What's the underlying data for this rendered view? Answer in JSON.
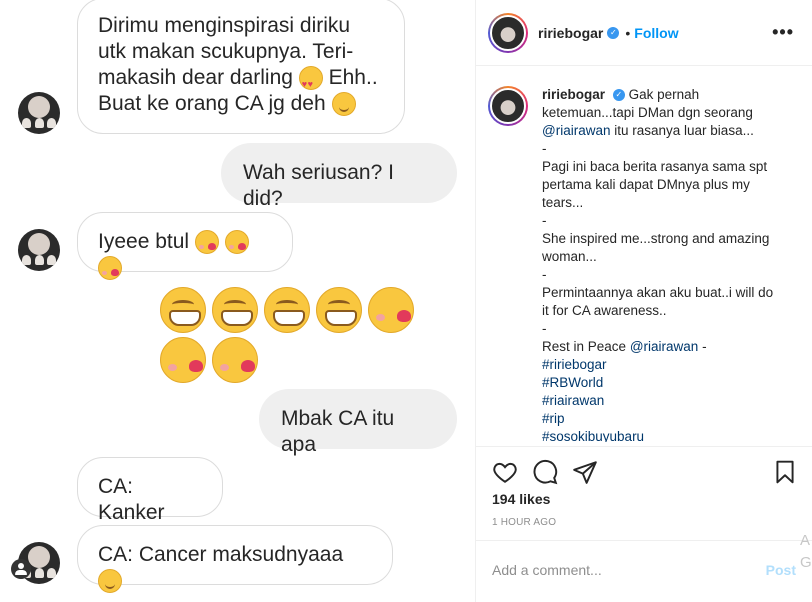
{
  "chat": {
    "messages": [
      {
        "side": "in",
        "text": "Dirimu menginspirasi diriku utk makan scukupnya. Teri-makasih dear darling",
        "emoji_after": "heart-eyes",
        "tail": "Ehh.. Buat ke orang CA jg deh",
        "tail_emoji": "smile"
      },
      {
        "side": "out",
        "text": "Wah seriusan? I did?"
      },
      {
        "side": "in",
        "text": "Iyeee btul"
      },
      {
        "side": "out",
        "text": "Mbak CA itu apa"
      },
      {
        "side": "in",
        "text": "CA: Kanker"
      },
      {
        "side": "in",
        "text": "CA: Cancer maksudnyaaa"
      }
    ],
    "line1": "Dirimu menginspirasi diriku",
    "line2": "utk makan scukupnya. Teri-",
    "line3": "makasih dear darling",
    "line3_tail": "Ehh..",
    "line4": "Buat ke orang CA jg deh",
    "reply1": "Wah seriusan? I did?",
    "msg2": "Iyeee btul",
    "reply2": "Mbak CA itu apa",
    "msg3": "CA: Kanker",
    "msg4": "CA: Cancer maksudnyaaa",
    "emoji_row": [
      "grinning-face",
      "grinning-face",
      "grinning-face",
      "grinning-face",
      "kissing-face",
      "kissing-face",
      "kissing-face"
    ]
  },
  "post": {
    "username": "ririebogar",
    "follow_label": "Follow",
    "more_icon": "•••",
    "caption": {
      "username": "ririebogar",
      "lines": [
        "Gak pernah",
        "ketemuan...tapi DMan dgn seorang",
        "@riairawan itu rasanya luar biasa...",
        "-",
        "Pagi ini baca berita rasanya sama spt",
        "pertama kali dapat DMnya plus my",
        "tears...",
        "-",
        "She inspired me...strong and amazing",
        "woman...",
        "-",
        "Permintaannya akan aku buat..i will do",
        "it for CA awareness..",
        "-",
        "Rest in Peace",
        "#ririebogar",
        "#RBWorld",
        "#riairawan",
        "#rip",
        "#sosokibuyubaru"
      ],
      "mention": "@riairawan",
      "mention_tail": "itu rasanya luar biasa...",
      "rip_mention": "@riairawan",
      "rip_dash": "-"
    },
    "likes": "194 likes",
    "time_ago": "1 HOUR AGO",
    "comment_placeholder": "Add a comment...",
    "post_label": "Post",
    "corner_letters": "A G"
  },
  "colors": {
    "accent": "#0095f6",
    "link": "#00376b",
    "muted": "#8e8e8e",
    "bubble_out": "#efefef"
  }
}
